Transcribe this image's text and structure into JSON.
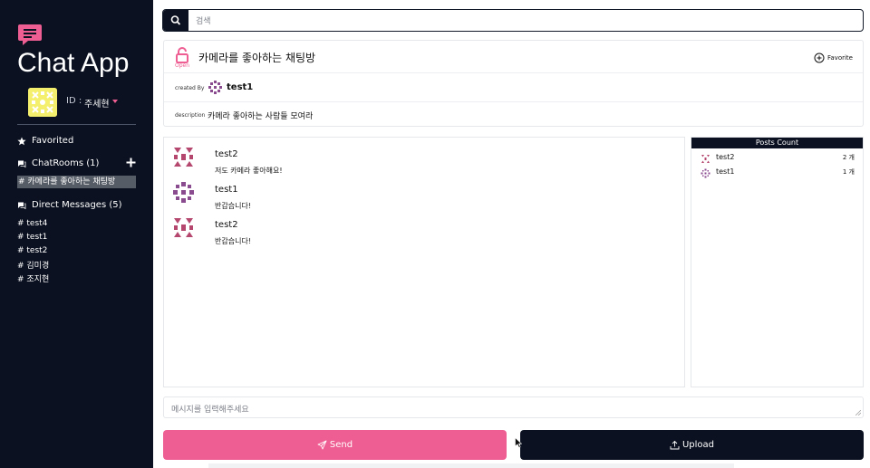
{
  "colors": {
    "sidebar_bg": "#0b1120",
    "accent": "#ef5e92",
    "dark_button": "#0b1120"
  },
  "sidebar": {
    "logo_icon": "chat-bubble-icon",
    "app_title": "Chat App",
    "user": {
      "id_label": "ID :",
      "name": "주세현"
    },
    "favorited_label": "Favorited",
    "chatrooms_label": "ChatRooms (1)",
    "chatrooms": [
      {
        "label": "# 카메라를 좋아하는 채팅방"
      }
    ],
    "direct_messages_label": "Direct Messages (5)",
    "direct_messages": [
      {
        "label": "# test4"
      },
      {
        "label": "# test1"
      },
      {
        "label": "# test2"
      },
      {
        "label": "# 김미경"
      },
      {
        "label": "# 조지현"
      }
    ]
  },
  "search": {
    "placeholder": "검색",
    "icon": "search-icon"
  },
  "room": {
    "lock_status": "Open",
    "title": "카메라를 좋아하는 채팅방",
    "favorite_label": "Favorite",
    "created_by_label": "created By",
    "creator": "test1",
    "description_label": "description",
    "description": "카메라 좋아하는 사람들 모여라"
  },
  "messages": [
    {
      "user": "test2",
      "text": "저도 카메라 좋아해요!"
    },
    {
      "user": "test1",
      "text": "반갑습니다!"
    },
    {
      "user": "test2",
      "text": "반갑습니다!"
    }
  ],
  "posts_count": {
    "title": "Posts Count",
    "rows": [
      {
        "user": "test2",
        "count": "2 개"
      },
      {
        "user": "test1",
        "count": "1 개"
      }
    ]
  },
  "composer": {
    "placeholder": "메시지를 입력해주세요",
    "send_label": "Send",
    "upload_label": "Upload"
  }
}
